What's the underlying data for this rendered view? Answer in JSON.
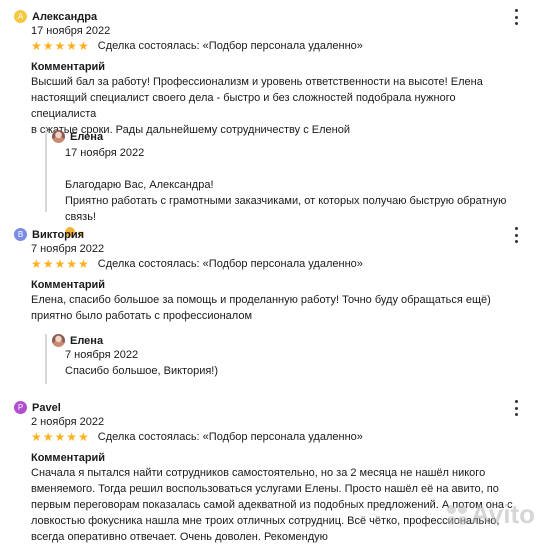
{
  "colors": {
    "stars": "#ffb021",
    "avatar_a": "#f5c842",
    "avatar_b": "#7a8ce6",
    "avatar_p": "#b04ecf"
  },
  "reviews": [
    {
      "initial": "А",
      "author": "Александра",
      "date": "17 ноября 2022",
      "stars": "★★★★★",
      "rating": 5,
      "deal": "Сделка состоялась: «Подбор персонала удаленно»",
      "comment_label": "Комментарий",
      "comment": "Высший бал за работу! Профессионализм и уровень ответственности на высоте! Елена\nнастоящий специалист своего дела - быстро и без сложностей подобрала нужного специалиста\nв сжатые сроки. Рады дальнейшему сотрудничеству с Еленой",
      "reply": {
        "author": "Елена",
        "date": "17 ноября 2022",
        "text": "Благодарю Вас, Александра!\nПриятно работать с грамотными заказчиками, от которых получаю быструю обратную\nсвязь!"
      }
    },
    {
      "initial": "В",
      "author": "Виктория",
      "date": "7 ноября 2022",
      "stars": "★★★★★",
      "rating": 5,
      "deal": "Сделка состоялась: «Подбор персонала удаленно»",
      "comment_label": "Комментарий",
      "comment": "Елена, спасибо большое за помощь и проделанную работу! Точно буду обращаться ещё)\nприятно было работать с профессионалом",
      "reply": {
        "author": "Елена",
        "date": "7 ноября 2022",
        "text": "Спасибо большое, Виктория!)"
      }
    },
    {
      "initial": "P",
      "author": "Pavel",
      "date": "2 ноября 2022",
      "stars": "★★★★★",
      "rating": 5,
      "deal": "Сделка состоялась: «Подбор персонала удаленно»",
      "comment_label": "Комментарий",
      "comment": "Сначала я пытался найти сотрудников самостоятельно, но за 2 месяца не нашёл никого\nвменяемого. Тогда решил воспользоваться услугами Елены. Просто нашёл её на авито, по\nпервым переговорам показалась самой адекватной из подобных предложений. А потом она с\nловкостью фокусника нашла мне троих отличных сотрудниц. Всё чётко, профессионально,\nвсегда оперативно отвечает. Очень доволен. Рекомендую"
    }
  ],
  "watermark": "Avito"
}
